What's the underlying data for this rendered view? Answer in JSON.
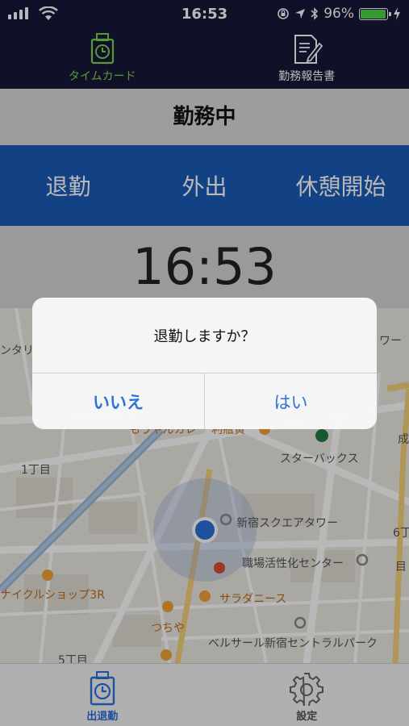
{
  "status_bar": {
    "time": "16:53",
    "battery": "96%"
  },
  "top_tabs": [
    {
      "label": "タイムカード",
      "icon": "timecard-icon",
      "active": true
    },
    {
      "label": "勤務報告書",
      "icon": "report-icon",
      "active": false
    }
  ],
  "header": {
    "title": "勤務中"
  },
  "actions": [
    {
      "label": "退勤"
    },
    {
      "label": "外出"
    },
    {
      "label": "休憩開始"
    }
  ],
  "clock": {
    "time": "16:53"
  },
  "map": {
    "labels": {
      "l1": "ンタリ",
      "l2": "ワー",
      "l3": "もうやんカレー 利瓶黄",
      "l4": "1丁目",
      "l5": "スターバックス",
      "l6": "成",
      "l7": "新宿スクエアタワー",
      "l8": "6丁",
      "l9": "職場活性化センター",
      "l10": "ナイクルショップ3R",
      "l11": "サラダニース",
      "l12": "つちや",
      "l13": "ベルサール新宿セントラルパーク",
      "l14": "5丁目",
      "l15": "目"
    }
  },
  "dialog": {
    "message": "退勤しますか？",
    "no_label": "いいえ",
    "yes_label": "はい"
  },
  "bottom_tabs": [
    {
      "label": "出退勤",
      "icon": "timecard-icon",
      "active": true
    },
    {
      "label": "設定",
      "icon": "gear-icon",
      "active": false
    }
  ],
  "colors": {
    "accent": "#2d72d9",
    "navy": "#17183a",
    "action_bar": "#1a5ab7",
    "active_tab": "#7bd34a"
  }
}
